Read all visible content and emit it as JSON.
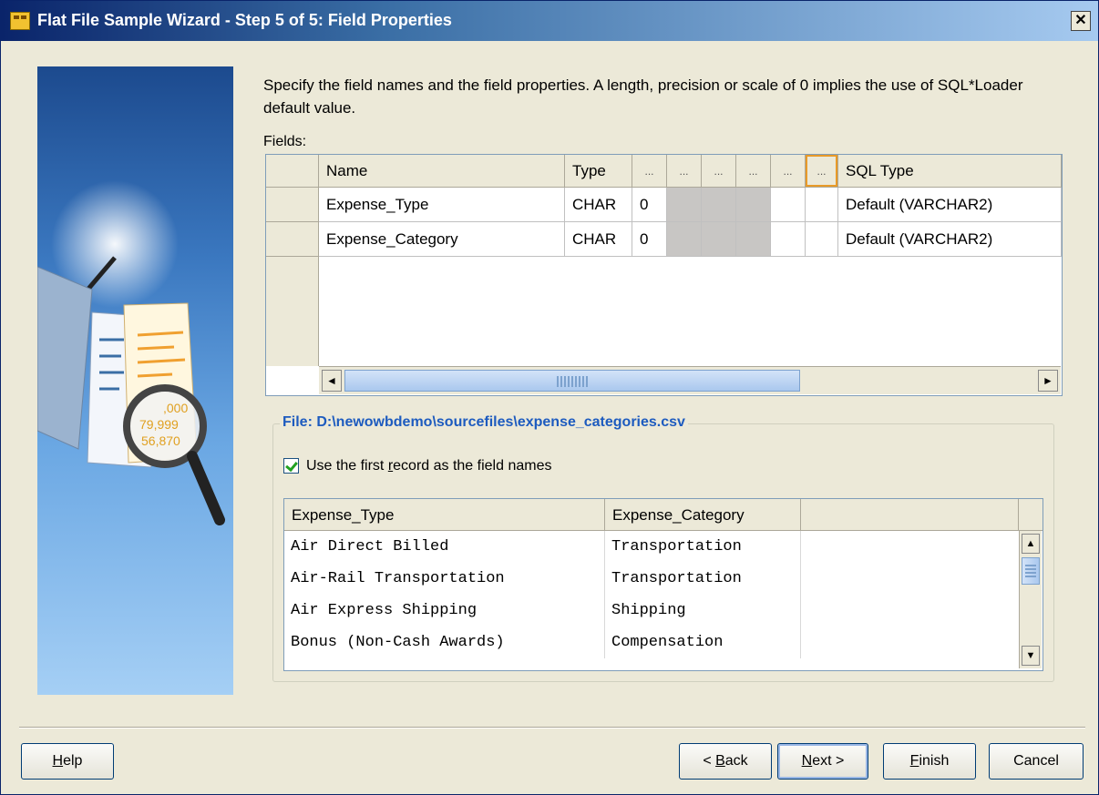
{
  "window": {
    "title": "Flat File Sample Wizard - Step 5 of 5: Field Properties",
    "close_glyph": "✕"
  },
  "instructions": "Specify the field names and the field properties.  A length, precision or scale of 0 implies the use of SQL*Loader default value.",
  "fields_label": "Fields:",
  "fields_table": {
    "columns": [
      "Name",
      "Type",
      "...",
      "...",
      "...",
      "...",
      "...",
      "...",
      "SQL Type"
    ],
    "rows": [
      {
        "name": "Expense_Type",
        "type": "CHAR",
        "length": "0",
        "sql_type": "Default (VARCHAR2)"
      },
      {
        "name": "Expense_Category",
        "type": "CHAR",
        "length": "0",
        "sql_type": "Default (VARCHAR2)"
      }
    ],
    "hscroll_left": "◄",
    "hscroll_right": "►"
  },
  "file_section": {
    "legend": "File: D:\\newowbdemo\\sourcefiles\\expense_categories.csv",
    "checkbox_label_pre": "Use the first ",
    "checkbox_label_underlined": "r",
    "checkbox_label_post": "ecord as the field names",
    "checkbox_checked": true
  },
  "preview_table": {
    "columns": [
      "Expense_Type",
      "Expense_Category"
    ],
    "rows": [
      [
        "Air Direct Billed",
        "Transportation"
      ],
      [
        "Air-Rail Transportation",
        "Transportation"
      ],
      [
        "Air Express Shipping",
        "Shipping"
      ],
      [
        "Bonus (Non-Cash Awards)",
        "Compensation"
      ]
    ],
    "vscroll_up": "▲",
    "vscroll_down": "▼"
  },
  "buttons": {
    "help_u": "H",
    "help_rest": "elp",
    "back_pre": "< ",
    "back_u": "B",
    "back_rest": "ack",
    "next_u": "N",
    "next_rest": "ext >",
    "finish_u": "F",
    "finish_rest": "inish",
    "cancel": "Cancel"
  }
}
